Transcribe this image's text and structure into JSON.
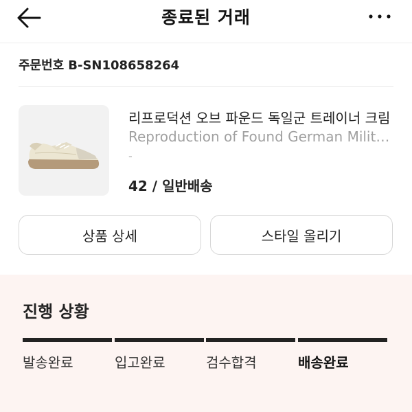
{
  "header": {
    "title": "종료된 거래",
    "back_icon": "arrow-left-icon",
    "more_icon": "more-dots-icon"
  },
  "order": {
    "label": "주문번호",
    "number": "B-SN108658264"
  },
  "product": {
    "image_icon": "sneaker-image",
    "name_ko": "리프로덕션 오브 파운드 독일군 트레이너 크림",
    "name_en": "Reproduction of Found German Military Trainer Cream",
    "sub": "-",
    "option": "42 / 일반배송"
  },
  "buttons": {
    "detail": "상품 상세",
    "style": "스타일 올리기"
  },
  "progress": {
    "title": "진행 상황",
    "steps": [
      "발송완료",
      "입고완료",
      "검수합격",
      "배송완료"
    ],
    "current_step": 4
  },
  "colors": {
    "progress_bg": "#fdf4f2",
    "bar": "#222222"
  }
}
